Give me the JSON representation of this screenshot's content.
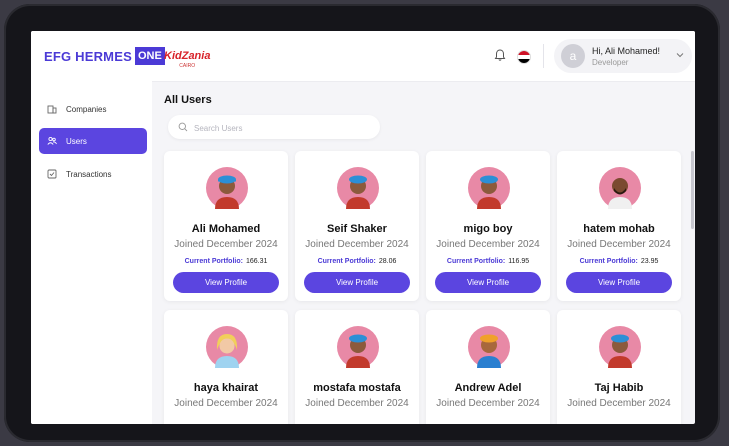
{
  "header": {
    "brand": "EFG HERMES",
    "brand_suffix": "ONE",
    "partner_logo": "KidZania",
    "partner_logo_sub": "CAIRO",
    "user_initial": "a",
    "user_name": "Hi, Ali Mohamed!",
    "user_role": "Developer"
  },
  "sidebar": {
    "items": [
      {
        "label": "Companies",
        "icon": "building-icon"
      },
      {
        "label": "Users",
        "icon": "users-icon",
        "active": true
      },
      {
        "label": "Transactions",
        "icon": "transactions-icon"
      }
    ]
  },
  "main": {
    "title": "All Users",
    "search_placeholder": "Search Users",
    "portfolio_label": "Current Portfolio:",
    "view_button": "View Profile",
    "users": [
      {
        "name": "Ali Mohamed",
        "joined": "Joined December 2024",
        "portfolio": "166.31"
      },
      {
        "name": "Seif Shaker",
        "joined": "Joined December 2024",
        "portfolio": "28.06"
      },
      {
        "name": "migo boy",
        "joined": "Joined December 2024",
        "portfolio": "116.95"
      },
      {
        "name": "hatem mohab",
        "joined": "Joined December 2024",
        "portfolio": "23.95"
      },
      {
        "name": "haya khairat",
        "joined": "Joined December 2024",
        "portfolio": ""
      },
      {
        "name": "mostafa mostafa",
        "joined": "Joined December 2024",
        "portfolio": ""
      },
      {
        "name": "Andrew Adel",
        "joined": "Joined December 2024",
        "portfolio": ""
      },
      {
        "name": "Taj Habib",
        "joined": "Joined December 2024",
        "portfolio": ""
      }
    ]
  },
  "colors": {
    "accent": "#5b45e0",
    "brand": "#4b3ad6"
  }
}
